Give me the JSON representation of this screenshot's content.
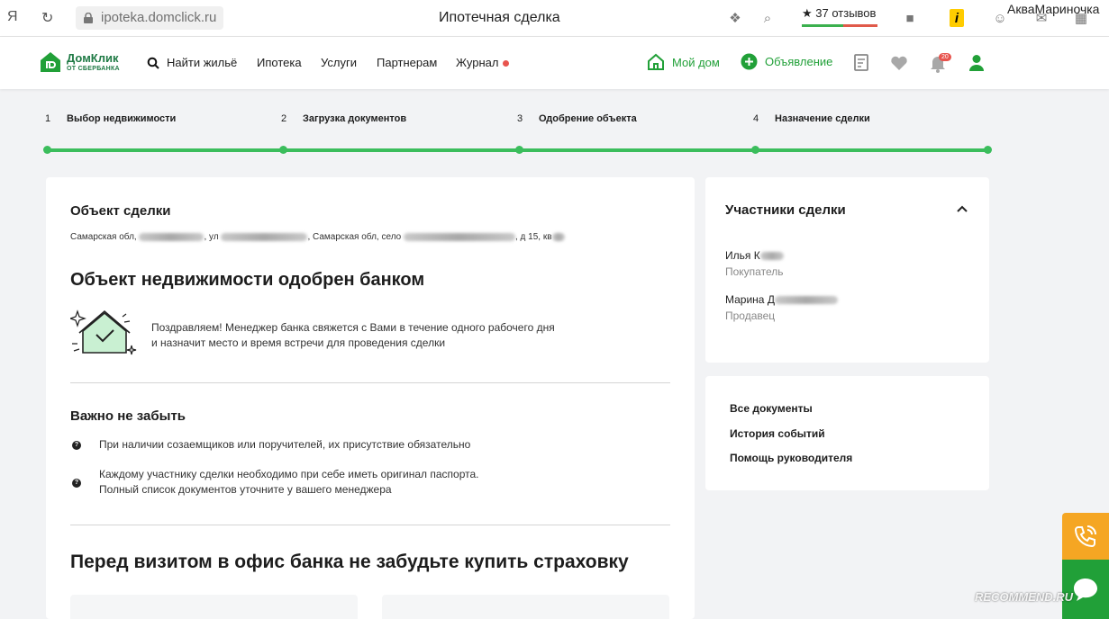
{
  "browser": {
    "yandex_logo": "Я",
    "url": "ipoteka.domclick.ru",
    "page_title": "Ипотечная сделка",
    "reviews": "★ 37 отзывов",
    "profile_name": "АкваМариночка"
  },
  "header": {
    "logo_title": "ДомКлик",
    "logo_sub": "ОТ СБЕРБАНКА",
    "nav": {
      "find_home": "Найти жильё",
      "mortgage": "Ипотека",
      "services": "Услуги",
      "partners": "Партнерам",
      "journal": "Журнал"
    },
    "my_home": "Мой дом",
    "listing": "Объявление",
    "notif_count": "20"
  },
  "stepper": {
    "steps": [
      {
        "num": "1",
        "label": "Выбор недвижимости"
      },
      {
        "num": "2",
        "label": "Загрузка документов"
      },
      {
        "num": "3",
        "label": "Одобрение объекта"
      },
      {
        "num": "4",
        "label": "Назначение сделки"
      }
    ],
    "progress": 1.0
  },
  "main": {
    "object_title": "Объект сделки",
    "address_parts": [
      "Самарская обл, ",
      ", ул ",
      ", Самарская обл, село ",
      ", д 15, кв"
    ],
    "approved_title": "Объект недвижимости одобрен банком",
    "congrats_line1": "Поздравляем! Менеджер банка свяжется с Вами в течение одного рабочего дня",
    "congrats_line2": "и назначит место и время встречи для проведения сделки",
    "remember_title": "Важно не забыть",
    "reminders": [
      {
        "text1": "При наличии созаемщиков или поручителей, их присутствие обязательно",
        "text2": ""
      },
      {
        "text1": "Каждому участнику сделки необходимо при себе иметь оригинал паспорта.",
        "text2": "Полный список документов уточните у вашего менеджера"
      }
    ],
    "insurance_title": "Перед визитом в офис банка не забудьте купить страховку"
  },
  "participants": {
    "title": "Участники сделки",
    "people": [
      {
        "name": "Илья К",
        "role": "Покупатель"
      },
      {
        "name": "Марина Д",
        "role": "Продавец"
      }
    ]
  },
  "links": {
    "all_docs": "Все документы",
    "history": "История событий",
    "help": "Помощь руководителя"
  },
  "watermark": "RECOMMEND.RU",
  "colors": {
    "brand_green": "#21a038",
    "progress_green": "#3bbd5c",
    "accent_orange": "#f5a623",
    "alert_red": "#e8544e"
  }
}
